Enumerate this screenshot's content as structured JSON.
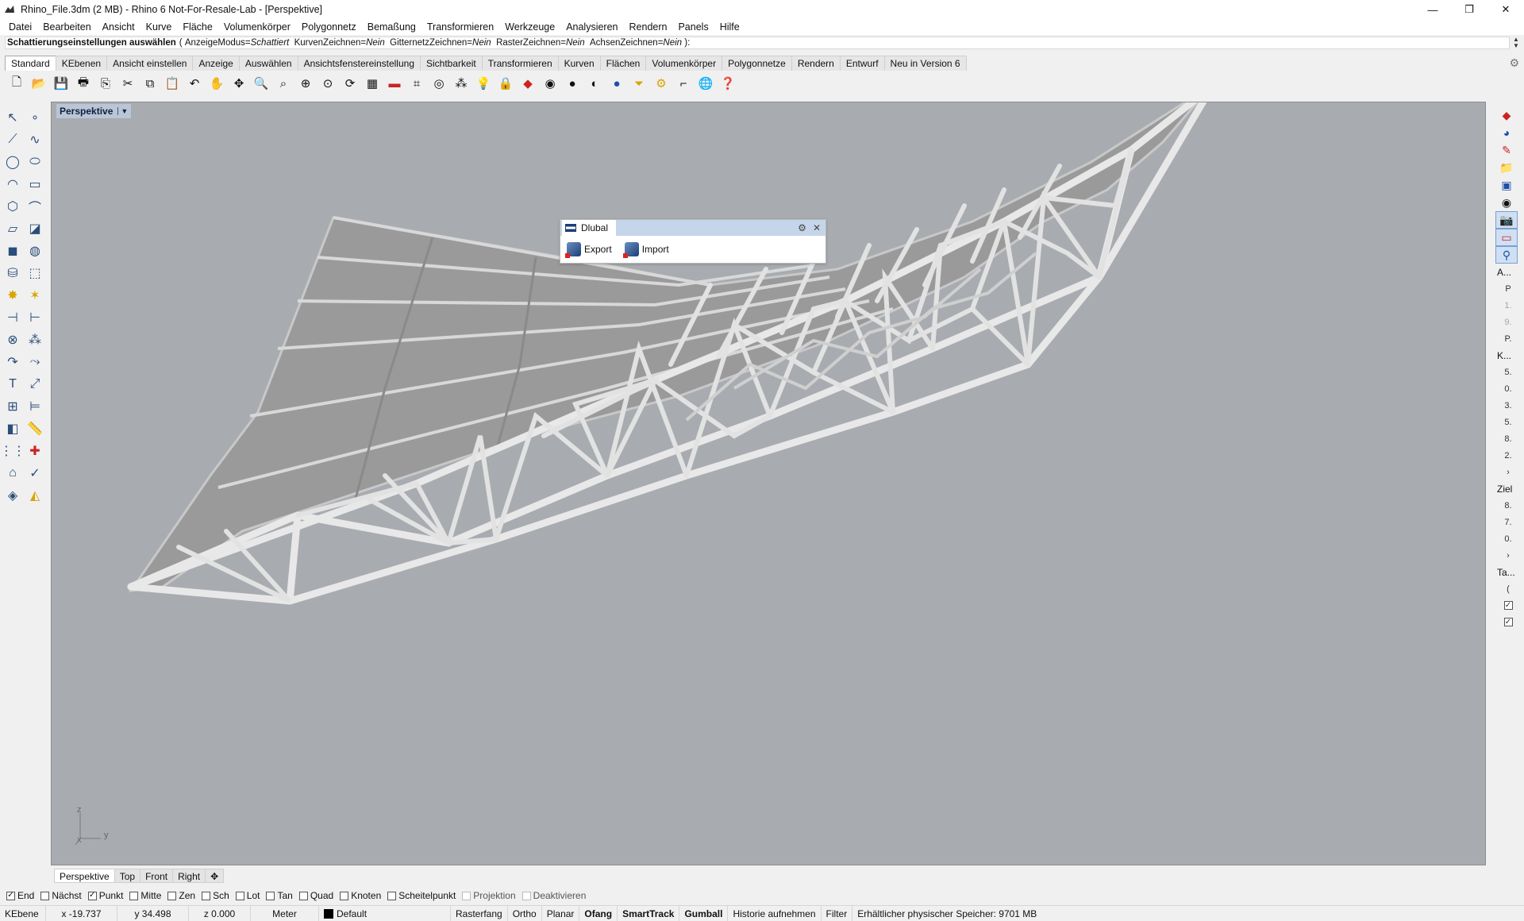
{
  "window": {
    "title": "Rhino_File.3dm (2 MB) - Rhino 6 Not-For-Resale-Lab - [Perspektive]",
    "minimize": "—",
    "restore": "❐",
    "close": "✕"
  },
  "menu": [
    "Datei",
    "Bearbeiten",
    "Ansicht",
    "Kurve",
    "Fläche",
    "Volumenkörper",
    "Polygonnetz",
    "Bemaßung",
    "Transformieren",
    "Werkzeuge",
    "Analysieren",
    "Rendern",
    "Panels",
    "Hilfe"
  ],
  "command": {
    "prompt": "Schattierungseinstellungen auswählen",
    "open": "(",
    "options": [
      {
        "key": "AnzeigeModus",
        "value": "Schattiert"
      },
      {
        "key": "KurvenZeichnen",
        "value": "Nein"
      },
      {
        "key": "GitternetzZeichnen",
        "value": "Nein"
      },
      {
        "key": "RasterZeichnen",
        "value": "Nein"
      },
      {
        "key": "AchsenZeichnen",
        "value": "Nein"
      }
    ],
    "close": "):"
  },
  "toolbar_tabs": [
    "Standard",
    "KEbenen",
    "Ansicht einstellen",
    "Anzeige",
    "Auswählen",
    "Ansichtsfenstereinstellung",
    "Sichtbarkeit",
    "Transformieren",
    "Kurven",
    "Flächen",
    "Volumenkörper",
    "Polygonnetze",
    "Rendern",
    "Entwurf",
    "Neu in Version 6"
  ],
  "viewport": {
    "label": "Perspektive",
    "axis_z": "z",
    "axis_y": "y",
    "axis_x": "x"
  },
  "dlubal": {
    "title": "Dlubal",
    "export_label": "Export",
    "import_label": "Import"
  },
  "viewport_tabs": [
    "Perspektive",
    "Top",
    "Front",
    "Right"
  ],
  "osnaps": [
    {
      "label": "End",
      "checked": true
    },
    {
      "label": "Nächst",
      "checked": false
    },
    {
      "label": "Punkt",
      "checked": true
    },
    {
      "label": "Mitte",
      "checked": false
    },
    {
      "label": "Zen",
      "checked": false
    },
    {
      "label": "Sch",
      "checked": false
    },
    {
      "label": "Lot",
      "checked": false
    },
    {
      "label": "Tan",
      "checked": false
    },
    {
      "label": "Quad",
      "checked": false
    },
    {
      "label": "Knoten",
      "checked": false
    },
    {
      "label": "Scheitelpunkt",
      "checked": false
    },
    {
      "label": "Projektion",
      "checked": false,
      "disabled": true
    },
    {
      "label": "Deaktivieren",
      "checked": false,
      "disabled": true
    }
  ],
  "status": {
    "layer_label": "KEbene",
    "x": "x -19.737",
    "y": "y 34.498",
    "z": "z 0.000",
    "units": "Meter",
    "layer": "Default",
    "rasterfang": "Rasterfang",
    "ortho": "Ortho",
    "planar": "Planar",
    "ofang": "Ofang",
    "smarttrack": "SmartTrack",
    "gumball": "Gumball",
    "historie": "Historie aufnehmen",
    "filter": "Filter",
    "memory": "Erhältlicher physischer Speicher: 9701 MB"
  },
  "right_panel": {
    "labels": [
      "A...",
      "P",
      "1.",
      "9.",
      "P.",
      "K...",
      "5.",
      "0.",
      "3.",
      "5.",
      "8.",
      "2.",
      "Ziel",
      "8.",
      "7.",
      "0.",
      "Ta...",
      "("
    ]
  },
  "colors": {
    "viewport_bg": "#a8acb0",
    "structure": "#e6e6e6",
    "roof": "#9c9c9c",
    "accent": "#c6d6ea"
  }
}
